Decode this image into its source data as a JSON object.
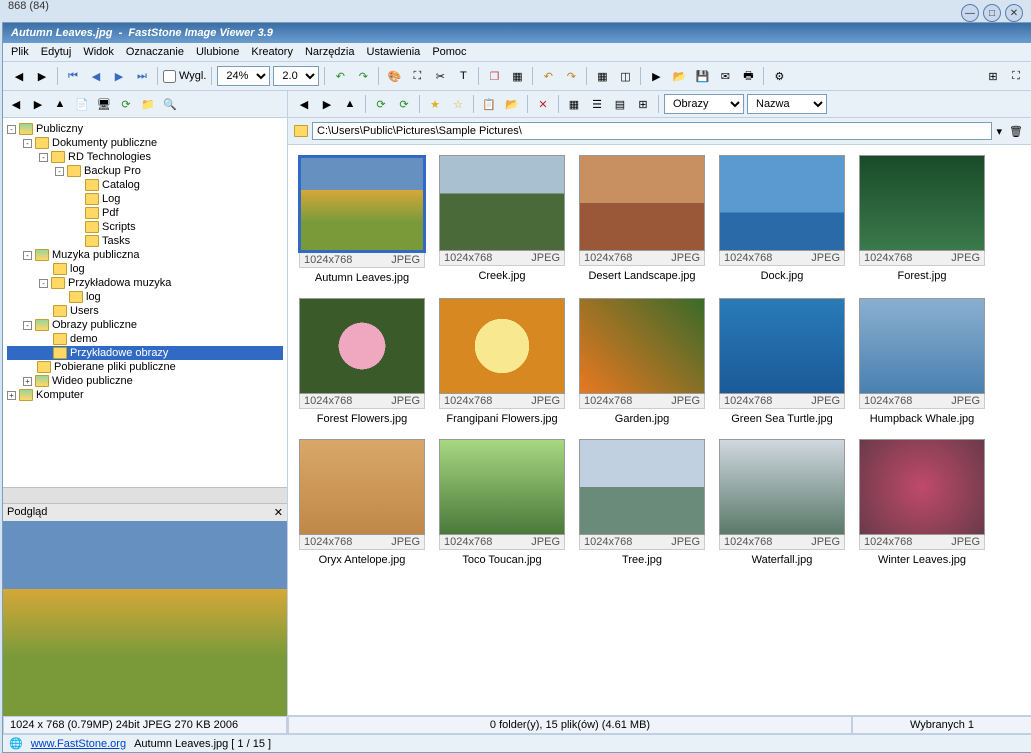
{
  "topcorner": "868 (84)",
  "title_file": "Autumn Leaves.jpg",
  "title_app": "FastStone Image Viewer 3.9",
  "menu": [
    "Plik",
    "Edytuj",
    "Widok",
    "Oznaczanie",
    "Ulubione",
    "Kreatory",
    "Narzędzia",
    "Ustawienia",
    "Pomoc"
  ],
  "toolbar": {
    "wygl_label": "Wygl.",
    "zoom": "24%",
    "sec": "2.0"
  },
  "main_toolbar": {
    "filter_label": "Obrazy",
    "sort_label": "Nazwa"
  },
  "path": "C:\\Users\\Public\\Pictures\\Sample Pictures\\",
  "tree": [
    {
      "level": 0,
      "toggle": "-",
      "icon": "special",
      "label": "Publiczny"
    },
    {
      "level": 1,
      "toggle": "-",
      "icon": "folder",
      "label": "Dokumenty publiczne"
    },
    {
      "level": 2,
      "toggle": "-",
      "icon": "folder",
      "label": "RD Technologies"
    },
    {
      "level": 3,
      "toggle": "-",
      "icon": "folder",
      "label": "Backup Pro"
    },
    {
      "level": 4,
      "toggle": "",
      "icon": "folder",
      "label": "Catalog"
    },
    {
      "level": 4,
      "toggle": "",
      "icon": "folder",
      "label": "Log"
    },
    {
      "level": 4,
      "toggle": "",
      "icon": "folder",
      "label": "Pdf"
    },
    {
      "level": 4,
      "toggle": "",
      "icon": "folder",
      "label": "Scripts"
    },
    {
      "level": 4,
      "toggle": "",
      "icon": "folder",
      "label": "Tasks"
    },
    {
      "level": 1,
      "toggle": "-",
      "icon": "special",
      "label": "Muzyka publiczna"
    },
    {
      "level": 2,
      "toggle": "",
      "icon": "folder",
      "label": "log"
    },
    {
      "level": 2,
      "toggle": "-",
      "icon": "folder",
      "label": "Przykładowa muzyka"
    },
    {
      "level": 3,
      "toggle": "",
      "icon": "folder",
      "label": "log"
    },
    {
      "level": 2,
      "toggle": "",
      "icon": "folder",
      "label": "Users"
    },
    {
      "level": 1,
      "toggle": "-",
      "icon": "special",
      "label": "Obrazy publiczne"
    },
    {
      "level": 2,
      "toggle": "",
      "icon": "folder",
      "label": "demo"
    },
    {
      "level": 2,
      "toggle": "",
      "icon": "folder",
      "label": "Przykładowe obrazy",
      "selected": true
    },
    {
      "level": 1,
      "toggle": "",
      "icon": "folder",
      "label": "Pobierane pliki publiczne"
    },
    {
      "level": 1,
      "toggle": "+",
      "icon": "special",
      "label": "Wideo publiczne"
    },
    {
      "level": 0,
      "toggle": "+",
      "icon": "special",
      "label": "Komputer"
    }
  ],
  "preview_label": "Podgląd",
  "thumbs": [
    {
      "name": "Autumn Leaves.jpg",
      "dim": "1024x768",
      "fmt": "JPEG",
      "cls": "ph-autumn",
      "selected": true
    },
    {
      "name": "Creek.jpg",
      "dim": "1024x768",
      "fmt": "JPEG",
      "cls": "ph-creek"
    },
    {
      "name": "Desert Landscape.jpg",
      "dim": "1024x768",
      "fmt": "JPEG",
      "cls": "ph-desert"
    },
    {
      "name": "Dock.jpg",
      "dim": "1024x768",
      "fmt": "JPEG",
      "cls": "ph-dock"
    },
    {
      "name": "Forest.jpg",
      "dim": "1024x768",
      "fmt": "JPEG",
      "cls": "ph-forest"
    },
    {
      "name": "Forest Flowers.jpg",
      "dim": "1024x768",
      "fmt": "JPEG",
      "cls": "ph-fflowers"
    },
    {
      "name": "Frangipani Flowers.jpg",
      "dim": "1024x768",
      "fmt": "JPEG",
      "cls": "ph-frangipani"
    },
    {
      "name": "Garden.jpg",
      "dim": "1024x768",
      "fmt": "JPEG",
      "cls": "ph-garden"
    },
    {
      "name": "Green Sea Turtle.jpg",
      "dim": "1024x768",
      "fmt": "JPEG",
      "cls": "ph-turtle"
    },
    {
      "name": "Humpback Whale.jpg",
      "dim": "1024x768",
      "fmt": "JPEG",
      "cls": "ph-whale"
    },
    {
      "name": "Oryx Antelope.jpg",
      "dim": "1024x768",
      "fmt": "JPEG",
      "cls": "ph-oryx"
    },
    {
      "name": "Toco Toucan.jpg",
      "dim": "1024x768",
      "fmt": "JPEG",
      "cls": "ph-toucan"
    },
    {
      "name": "Tree.jpg",
      "dim": "1024x768",
      "fmt": "JPEG",
      "cls": "ph-tree"
    },
    {
      "name": "Waterfall.jpg",
      "dim": "1024x768",
      "fmt": "JPEG",
      "cls": "ph-waterfall"
    },
    {
      "name": "Winter Leaves.jpg",
      "dim": "1024x768",
      "fmt": "JPEG",
      "cls": "ph-winter"
    }
  ],
  "status": {
    "imageinfo": "1024 x 768 (0.79MP)   24bit  JPEG   270 KB   2006",
    "folderinfo": "0 folder(y), 15 plik(ów) (4.61 MB)",
    "selection": "Wybranych 1"
  },
  "bottom": {
    "site": "www.FastStone.org",
    "current": "Autumn Leaves.jpg [ 1 / 15 ]"
  }
}
